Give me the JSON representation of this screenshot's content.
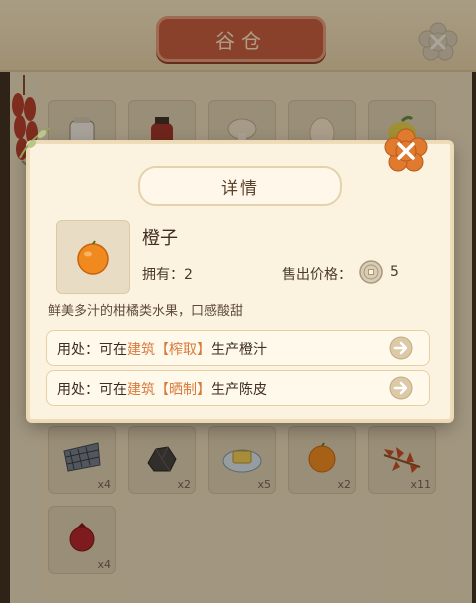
{
  "granary": {
    "title": "谷仓",
    "close_icon": "flower-close-icon",
    "slots_top": [
      {
        "icon": "rice-sack-icon"
      },
      {
        "icon": "jar-icon"
      },
      {
        "icon": "mushroom-icon"
      },
      {
        "icon": "egg-icon"
      },
      {
        "icon": "lemon-icon"
      }
    ],
    "slots": [
      {
        "icon": "fishing-net-icon",
        "count": "x4"
      },
      {
        "icon": "coal-icon",
        "count": "x2"
      },
      {
        "icon": "cake-plate-icon",
        "count": "x5"
      },
      {
        "icon": "orange-icon",
        "count": "x2"
      },
      {
        "icon": "maple-branch-icon",
        "count": "x11"
      },
      {
        "icon": "pomegranate-icon",
        "count": "x4"
      }
    ]
  },
  "detail": {
    "title": "详情",
    "close_icon": "flower-close-icon",
    "item_icon": "orange-icon",
    "item_name": "橙子",
    "own_label": "拥有：",
    "own_value": "2",
    "price_label": "售出价格：",
    "price_icon": "coin-icon",
    "price_value": "5",
    "description": "鲜美多汁的柑橘类水果，口感酸甜",
    "uses": [
      {
        "prefix": "用处：可在",
        "building": "建筑【榨取】",
        "suffix": "生产橙汁",
        "button_icon": "arrow-right-icon"
      },
      {
        "prefix": "用处：可在",
        "building": "建筑【晒制】",
        "suffix": "生产陈皮",
        "button_icon": "arrow-right-icon"
      }
    ]
  },
  "colors": {
    "accent": "#c35a3f",
    "highlight": "#d77a3c",
    "panel": "#fbf2df"
  }
}
